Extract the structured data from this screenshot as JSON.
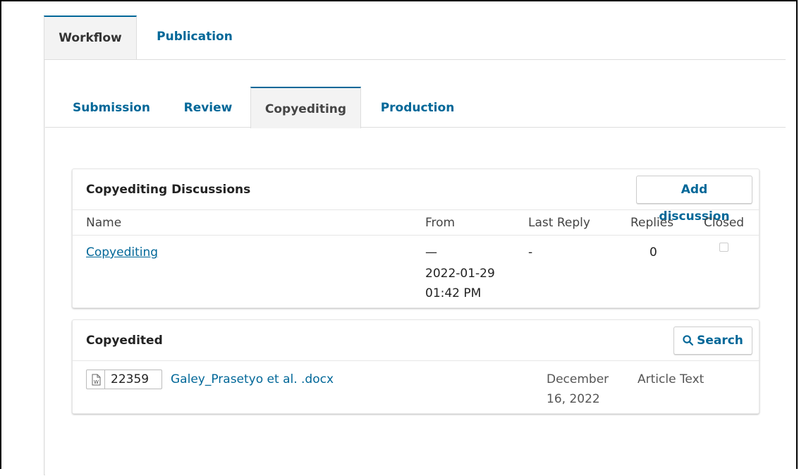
{
  "top_tabs": {
    "workflow": "Workflow",
    "publication": "Publication"
  },
  "stage_tabs": {
    "submission": "Submission",
    "review": "Review",
    "copyediting": "Copyediting",
    "production": "Production"
  },
  "discussions": {
    "title": "Copyediting Discussions",
    "add_button": "Add discussion",
    "columns": {
      "name": "Name",
      "from": "From",
      "last_reply": "Last Reply",
      "replies": "Replies",
      "closed": "Closed"
    },
    "rows": [
      {
        "name": "Copyediting",
        "from_dash": "—",
        "from_date": "2022-01-29",
        "from_time": "01:42 PM",
        "last_reply": "-",
        "replies": "0",
        "closed": false
      }
    ]
  },
  "copyedited": {
    "title": "Copyedited",
    "search_button": "Search",
    "files": [
      {
        "id": "22359",
        "name": "Galey_Prasetyo et al. .docx",
        "date_line1": "December",
        "date_line2": "16, 2022",
        "type": "Article Text",
        "icon": "word-doc-icon"
      }
    ]
  },
  "colors": {
    "accent": "#006798",
    "tab_bg": "#f3f3f3",
    "border": "#dddddd"
  }
}
